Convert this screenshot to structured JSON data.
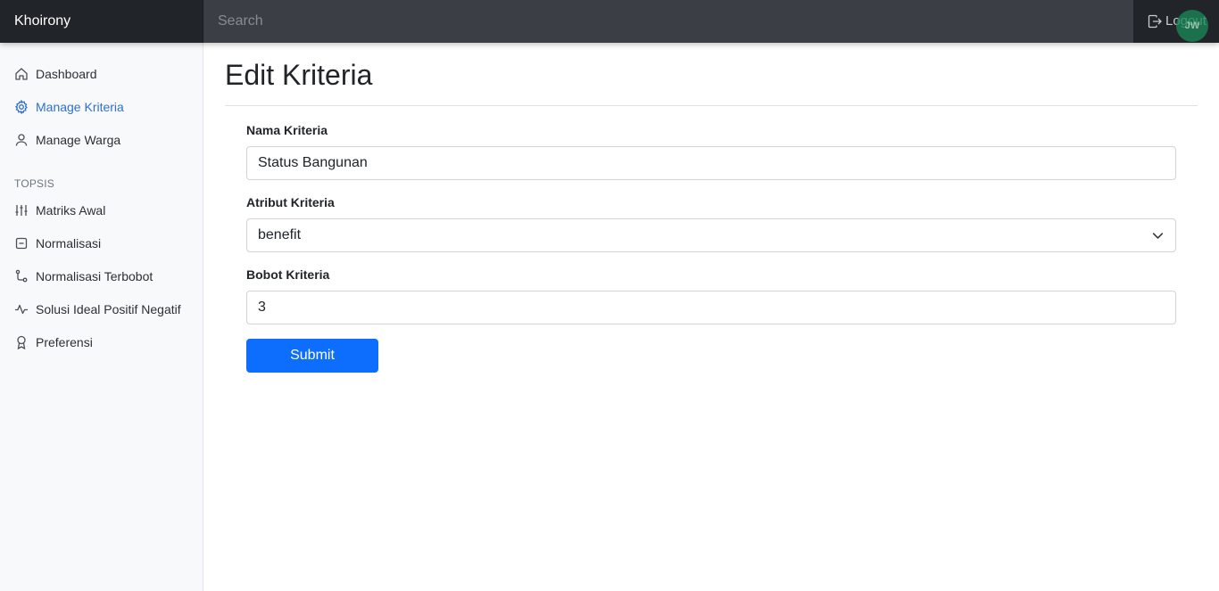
{
  "navbar": {
    "brand": "Khoirony",
    "search_placeholder": "Search",
    "logout_label": "Logout",
    "avatar_initials": "JW"
  },
  "sidebar": {
    "items": [
      {
        "label": "Dashboard",
        "icon": "house-icon",
        "active": false
      },
      {
        "label": "Manage Kriteria",
        "icon": "gear-icon",
        "active": true
      },
      {
        "label": "Manage Warga",
        "icon": "person-icon",
        "active": false
      }
    ],
    "section_heading": "TOPSIS",
    "topsis_items": [
      {
        "label": "Matriks Awal",
        "icon": "sliders-icon"
      },
      {
        "label": "Normalisasi",
        "icon": "file-minus-icon"
      },
      {
        "label": "Normalisasi Terbobot",
        "icon": "git-branch-icon"
      },
      {
        "label": "Solusi Ideal Positif Negatif",
        "icon": "activity-icon"
      },
      {
        "label": "Preferensi",
        "icon": "award-icon"
      }
    ]
  },
  "main": {
    "title": "Edit Kriteria",
    "form": {
      "nama_label": "Nama Kriteria",
      "nama_value": "Status Bangunan",
      "atribut_label": "Atribut Kriteria",
      "atribut_value": "benefit",
      "bobot_label": "Bobot Kriteria",
      "bobot_value": "3",
      "submit_label": "Submit"
    }
  },
  "colors": {
    "accent": "#0d6efd",
    "active_link": "#2f6fd1",
    "navbar": "#343a40",
    "brand_bg": "#212529",
    "avatar": "#198754"
  }
}
